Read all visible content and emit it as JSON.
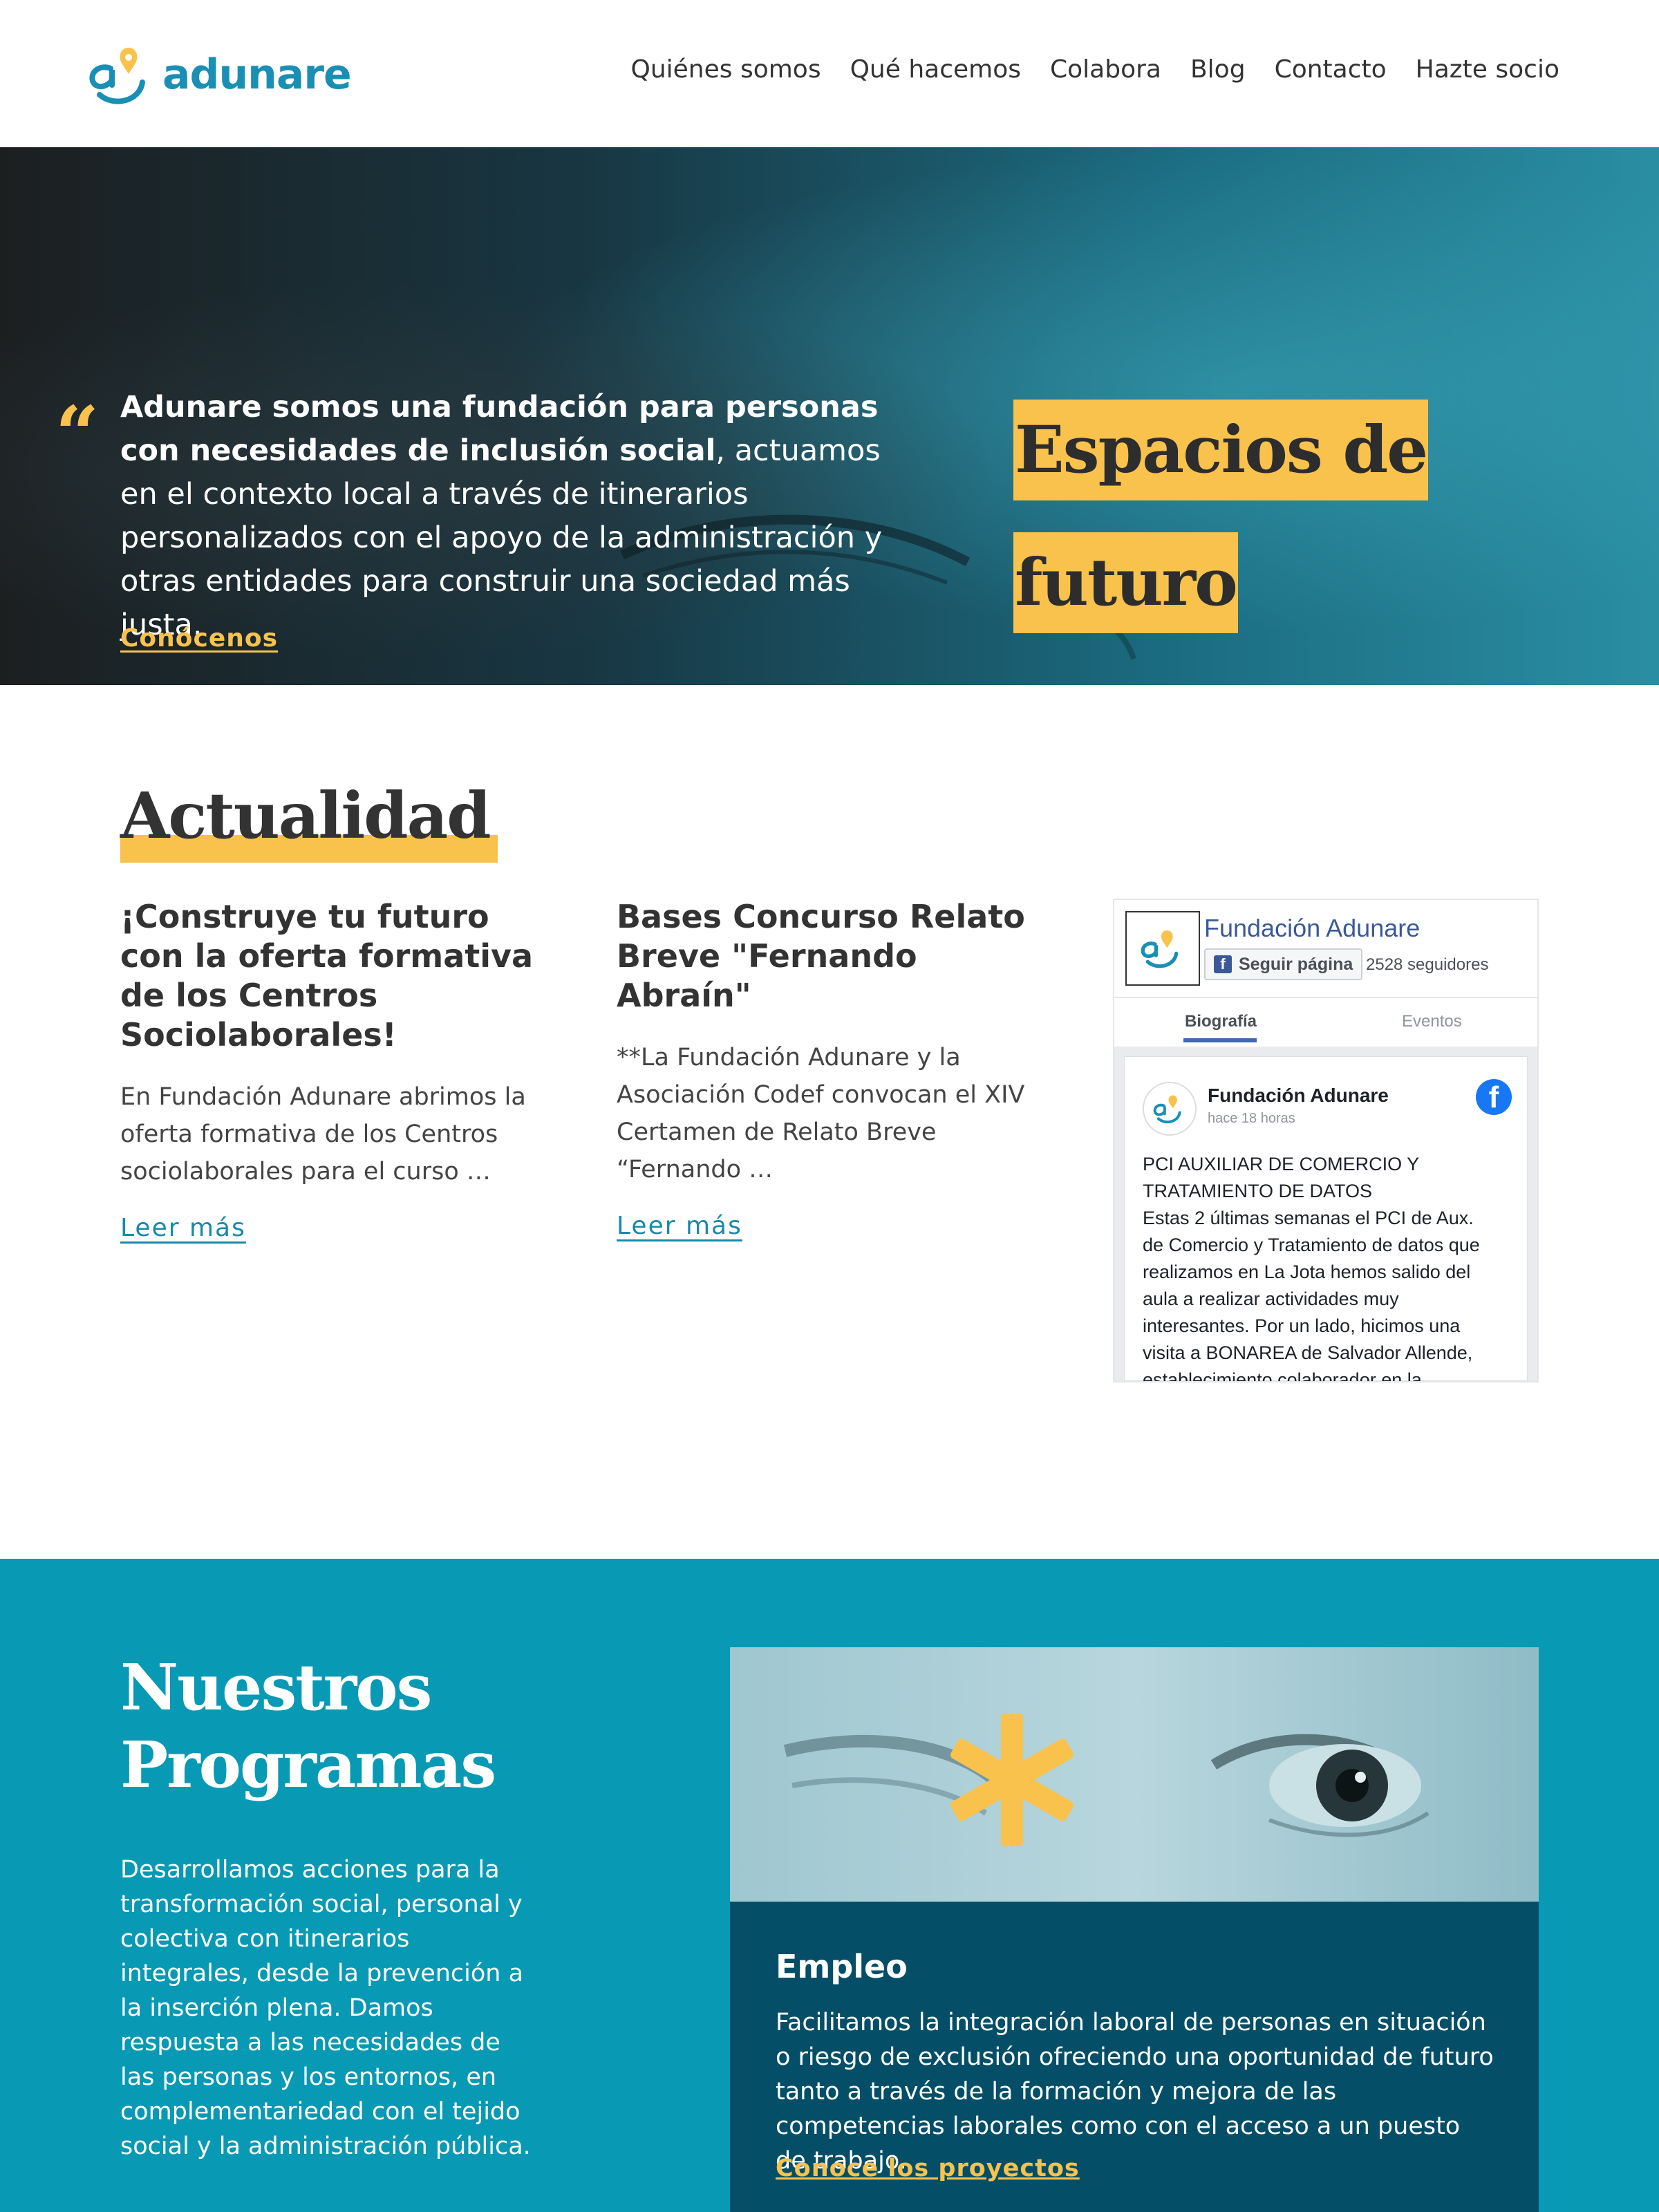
{
  "brand": {
    "name": "adunare",
    "primary_color": "#1a8fb5",
    "accent_color": "#f8c24d"
  },
  "nav": {
    "items": [
      "Quiénes somos",
      "Qué hacemos",
      "Colabora",
      "Blog",
      "Contacto",
      "Hazte socio"
    ]
  },
  "hero": {
    "quote_bold": "Adunare somos una fundación para personas con necesidades de inclusión social",
    "quote_rest": ", actuamos en el contexto local a través de itinerarios personalizados con el apoyo de la administración y otras entidades para construir una sociedad más justa.",
    "link": "Conócenos",
    "tagline_line1": "Espacios de",
    "tagline_line2": "futuro"
  },
  "actualidad": {
    "title": "Actualidad",
    "posts": [
      {
        "title": "¡Construye tu futuro con la oferta formativa de los Centros Sociolaborales!",
        "excerpt": "En Fundación Adunare abrimos la oferta formativa de los Centros sociolaborales para el curso …",
        "link": "Leer más"
      },
      {
        "title": "Bases Concurso Relato Breve \"Fernando Abraín\"",
        "excerpt": "**La Fundación Adunare y la Asociación Codef convocan el XIV Certamen de Relato Breve “Fernando …",
        "link": "Leer más"
      }
    ]
  },
  "facebook": {
    "page_name": "Fundación Adunare",
    "follow_label": "Seguir página",
    "followers": "2528 seguidores",
    "tabs": [
      "Biografía",
      "Eventos"
    ],
    "post": {
      "author": "Fundación Adunare",
      "time": "hace 18 horas",
      "text_lines": [
        "PCI AUXILIAR DE COMERCIO Y",
        "TRATAMIENTO DE DATOS",
        "Estas 2 últimas semanas el PCI de Aux.",
        "de Comercio y Tratamiento de datos que",
        "realizamos en La Jota hemos salido del",
        "aula a realizar actividades muy",
        "interesantes. Por un lado, hicimos una",
        "visita a BONAREA de Salvador Allende,",
        "establecimiento colaborador en la"
      ]
    }
  },
  "programas": {
    "title_line1": "Nuestros",
    "title_line2": "Programas",
    "description": "Desarrollamos acciones para la transformación social, personal y colectiva con itinerarios integrales, desde la prevención a la inserción plena. Damos respuesta a las necesidades de las personas y los entornos, en complementariedad con el tejido social y la administración pública.",
    "card": {
      "title": "Empleo",
      "text": "Facilitamos la integración laboral de personas en situación o riesgo de exclusión ofreciendo una oportunidad de futuro tanto a través de la formación y mejora de las competencias laborales como con el acceso a un puesto de trabajo.",
      "link": "Conoce los proyectos"
    }
  }
}
